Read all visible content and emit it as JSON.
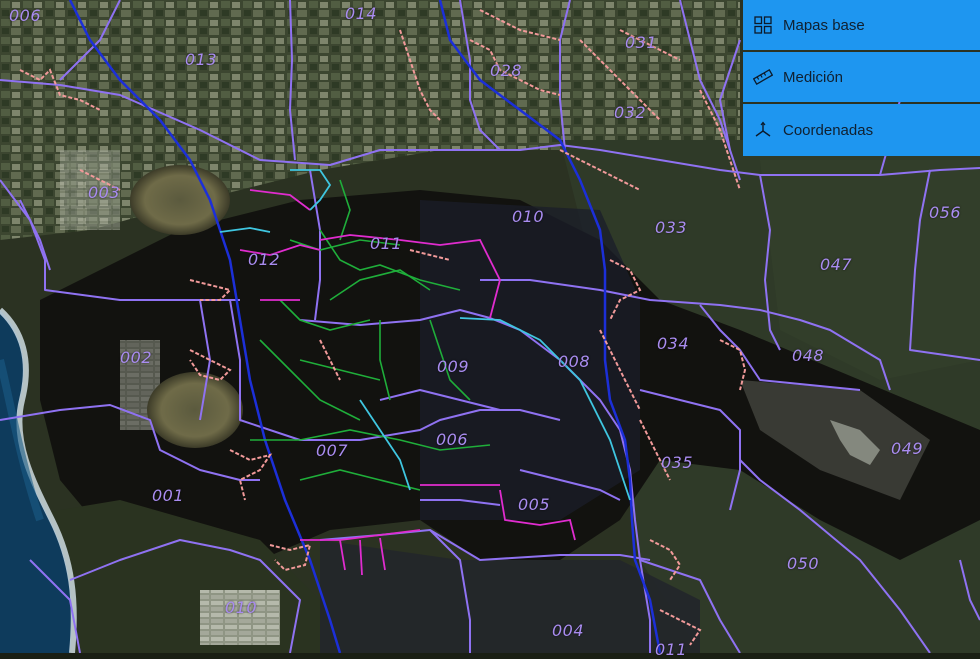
{
  "map": {
    "zones": [
      {
        "id": "006"
      },
      {
        "id": "014"
      },
      {
        "id": "013"
      },
      {
        "id": "031"
      },
      {
        "id": "028"
      },
      {
        "id": "032"
      },
      {
        "id": "003"
      },
      {
        "id": "010"
      },
      {
        "id": "033"
      },
      {
        "id": "056"
      },
      {
        "id": "011"
      },
      {
        "id": "012"
      },
      {
        "id": "047"
      },
      {
        "id": "034"
      },
      {
        "id": "048"
      },
      {
        "id": "009"
      },
      {
        "id": "008"
      },
      {
        "id": "002"
      },
      {
        "id": "006"
      },
      {
        "id": "007"
      },
      {
        "id": "049"
      },
      {
        "id": "035"
      },
      {
        "id": "001"
      },
      {
        "id": "005"
      },
      {
        "id": "050"
      },
      {
        "id": "010"
      },
      {
        "id": "004"
      },
      {
        "id": "011"
      }
    ]
  },
  "toolbar": {
    "basemaps_label": "Mapas base",
    "measure_label": "Medición",
    "coords_label": "Coordenadas"
  },
  "colors": {
    "boundary": "#8f72f2",
    "road_main": "#1c2fd8",
    "settlement": "#f29a9a",
    "track_green": "#1fae3a",
    "track_pink": "#e02ccf",
    "track_cyan": "#3fc6e0",
    "panel": "#1e96f0"
  }
}
